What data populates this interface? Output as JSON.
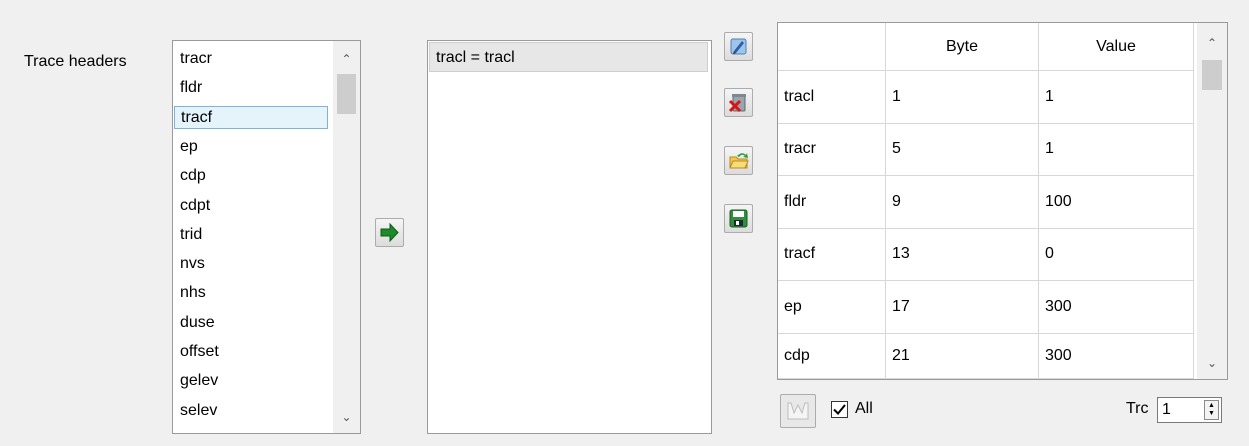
{
  "trace_headers_label": "Trace headers",
  "header_list": {
    "items": [
      "tracr",
      "fldr",
      "tracf",
      "ep",
      "cdp",
      "cdpt",
      "trid",
      "nvs",
      "nhs",
      "duse",
      "offset",
      "gelev",
      "selev"
    ],
    "selected_index": 2
  },
  "selected_list": {
    "items": [
      "tracl = tracl"
    ]
  },
  "table": {
    "columns": [
      "",
      "Byte",
      "Value"
    ],
    "rows": [
      {
        "name": "tracl",
        "byte": "1",
        "value": "1"
      },
      {
        "name": "tracr",
        "byte": "5",
        "value": "1"
      },
      {
        "name": "fldr",
        "byte": "9",
        "value": "100"
      },
      {
        "name": "tracf",
        "byte": "13",
        "value": "0"
      },
      {
        "name": "ep",
        "byte": "17",
        "value": "300"
      },
      {
        "name": "cdp",
        "byte": "21",
        "value": "300"
      }
    ]
  },
  "bottom": {
    "all_label": "All",
    "all_checked": true,
    "trc_label": "Trc",
    "trc_value": "1"
  },
  "icons": {
    "add": "arrow-right-icon",
    "edit": "pen-icon",
    "delete": "delete-icon",
    "open": "folder-open-icon",
    "save": "floppy-disk-icon",
    "plot": "plot-icon"
  }
}
